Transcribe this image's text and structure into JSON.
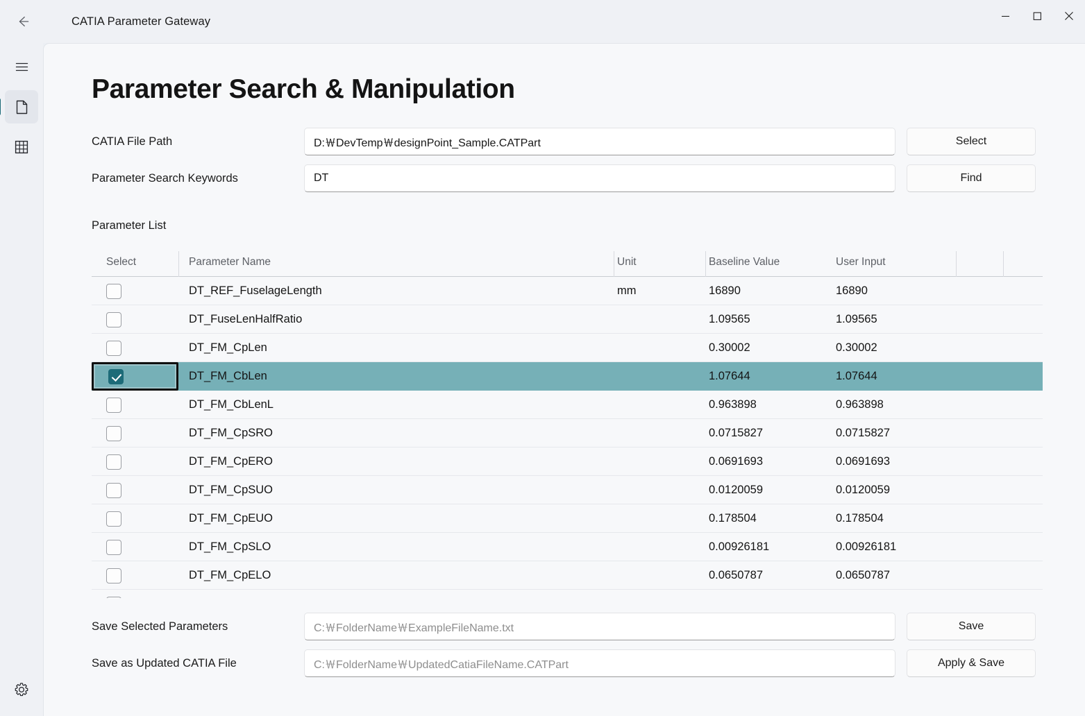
{
  "window": {
    "title": "CATIA Parameter Gateway",
    "back_icon": "back-arrow-icon",
    "minimize_label": "minimize-icon",
    "maximize_label": "maximize-icon",
    "close_label": "close-icon"
  },
  "rail": {
    "items": [
      {
        "icon": "hamburger-menu-icon",
        "selected": false
      },
      {
        "icon": "document-icon",
        "selected": true
      },
      {
        "icon": "grid-table-icon",
        "selected": false
      }
    ],
    "bottom": {
      "icon": "gear-icon"
    }
  },
  "page": {
    "title": "Parameter Search & Manipulation"
  },
  "form": {
    "file_path": {
      "label": "CATIA File Path",
      "value": "D:￦DevTemp￦designPoint_Sample.CATPart",
      "button": "Select"
    },
    "search_keywords": {
      "label": "Parameter Search Keywords",
      "value": "DT",
      "button": "Find"
    }
  },
  "list": {
    "caption": "Parameter List",
    "columns": [
      "Select",
      "Parameter Name",
      "Unit",
      "Baseline Value",
      "User Input",
      ""
    ],
    "rows": [
      {
        "checked": false,
        "name": "DT_REF_FuselageLength",
        "unit": "mm",
        "baseline": "16890",
        "user": "16890"
      },
      {
        "checked": false,
        "name": "DT_FuseLenHalfRatio",
        "unit": "",
        "baseline": "1.09565",
        "user": "1.09565"
      },
      {
        "checked": false,
        "name": "DT_FM_CpLen",
        "unit": "",
        "baseline": "0.30002",
        "user": "0.30002"
      },
      {
        "checked": true,
        "name": "DT_FM_CbLen",
        "unit": "",
        "baseline": "1.07644",
        "user": "1.07644"
      },
      {
        "checked": false,
        "name": "DT_FM_CbLenL",
        "unit": "",
        "baseline": "0.963898",
        "user": "0.963898"
      },
      {
        "checked": false,
        "name": "DT_FM_CpSRO",
        "unit": "",
        "baseline": "0.0715827",
        "user": "0.0715827"
      },
      {
        "checked": false,
        "name": "DT_FM_CpERO",
        "unit": "",
        "baseline": "0.0691693",
        "user": "0.0691693"
      },
      {
        "checked": false,
        "name": "DT_FM_CpSUO",
        "unit": "",
        "baseline": "0.0120059",
        "user": "0.0120059"
      },
      {
        "checked": false,
        "name": "DT_FM_CpEUO",
        "unit": "",
        "baseline": "0.178504",
        "user": "0.178504"
      },
      {
        "checked": false,
        "name": "DT_FM_CpSLO",
        "unit": "",
        "baseline": "0.00926181",
        "user": "0.00926181"
      },
      {
        "checked": false,
        "name": "DT_FM_CpELO",
        "unit": "",
        "baseline": "0.0650787",
        "user": "0.0650787"
      }
    ]
  },
  "save": {
    "selected_params": {
      "label": "Save Selected Parameters",
      "placeholder": "C:￦FolderName￦ExampleFileName.txt",
      "button": "Save"
    },
    "updated_file": {
      "label": "Save as Updated CATIA File",
      "placeholder": "C:￦FolderName￦UpdatedCatiaFileName.CATPart",
      "button": "Apply & Save"
    }
  },
  "colors": {
    "accent_teal": "#76b0b7",
    "accent_dark_teal": "#1d6b78",
    "surface": "#f7f8fa",
    "chrome": "#eff1f5"
  }
}
